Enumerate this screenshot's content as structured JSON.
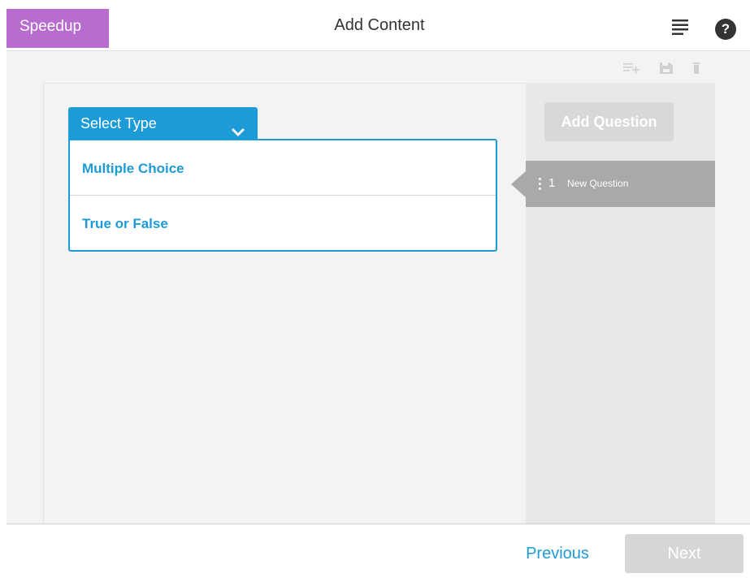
{
  "header": {
    "brand": "Speedup",
    "title": "Add Content",
    "menu_icon": "hamburger-menu-icon",
    "help_icon": "help-icon",
    "help_glyph": "?"
  },
  "toolbar": {
    "icons": [
      "add-list-icon",
      "save-icon",
      "trash-icon"
    ]
  },
  "editor": {
    "select_type": {
      "label": "Select Type",
      "options": [
        "Multiple Choice",
        "True or False"
      ]
    }
  },
  "side_panel": {
    "add_question_label": "Add Question",
    "questions": [
      {
        "number": "1",
        "label": "New Question"
      }
    ]
  },
  "footer": {
    "previous_label": "Previous",
    "next_label": "Next"
  },
  "colors": {
    "brand": "#b96cd0",
    "accent": "#1d9bd7",
    "disabled_button": "#d6d6d6",
    "selected_question": "#a9a9a9"
  }
}
